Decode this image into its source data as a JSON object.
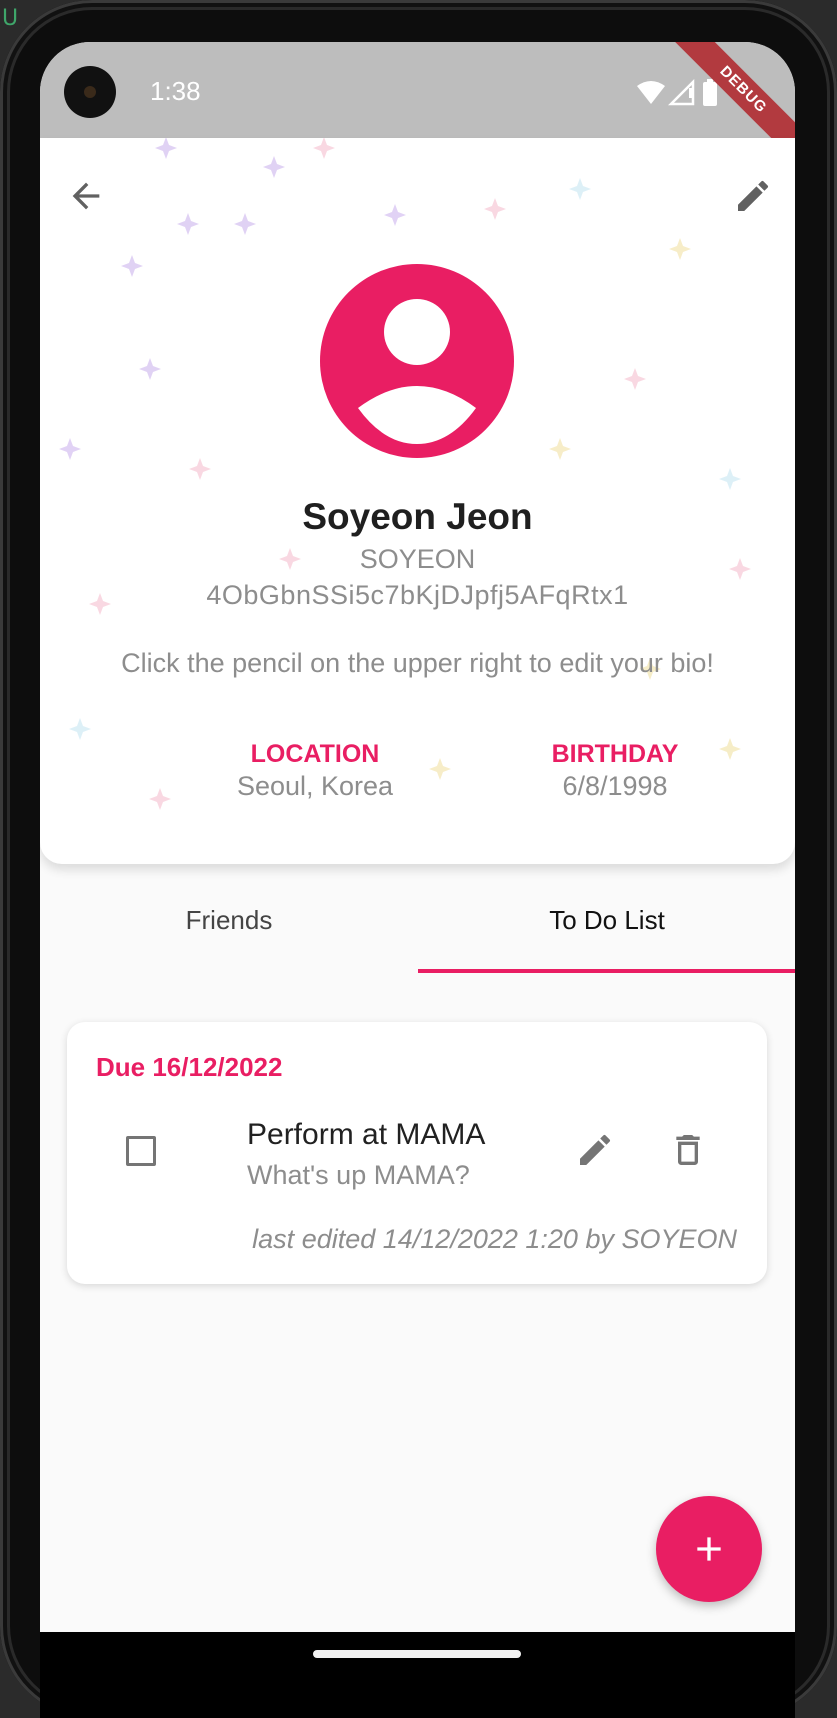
{
  "status_bar": {
    "time": "1:38",
    "debug_label": "DEBUG"
  },
  "corner_mark": "U",
  "profile": {
    "name": "Soyeon Jeon",
    "username": "SOYEON",
    "uid": "4ObGbnSSi5c7bKjDJpfj5AFqRtx1",
    "bio": "Click the pencil on the upper right to edit your bio!",
    "location_label": "LOCATION",
    "location_value": "Seoul, Korea",
    "birthday_label": "BIRTHDAY",
    "birthday_value": "6/8/1998"
  },
  "tabs": [
    {
      "label": "Friends",
      "selected": false
    },
    {
      "label": "To Do List",
      "selected": true
    }
  ],
  "todo": {
    "due": "Due 16/12/2022",
    "title": "Perform at MAMA",
    "subtitle": "What's up MAMA?",
    "checked": false,
    "last_edited": "last edited 14/12/2022 1:20 by SOYEON"
  },
  "icons": {
    "back": "arrow-back-icon",
    "edit": "pencil-icon",
    "avatar": "account-circle-icon",
    "delete": "trash-icon",
    "fab": "plus-icon"
  },
  "colors": {
    "accent": "#e91e63",
    "status_bar": "#bdbdbd",
    "muted_text": "#8d8d8d"
  }
}
